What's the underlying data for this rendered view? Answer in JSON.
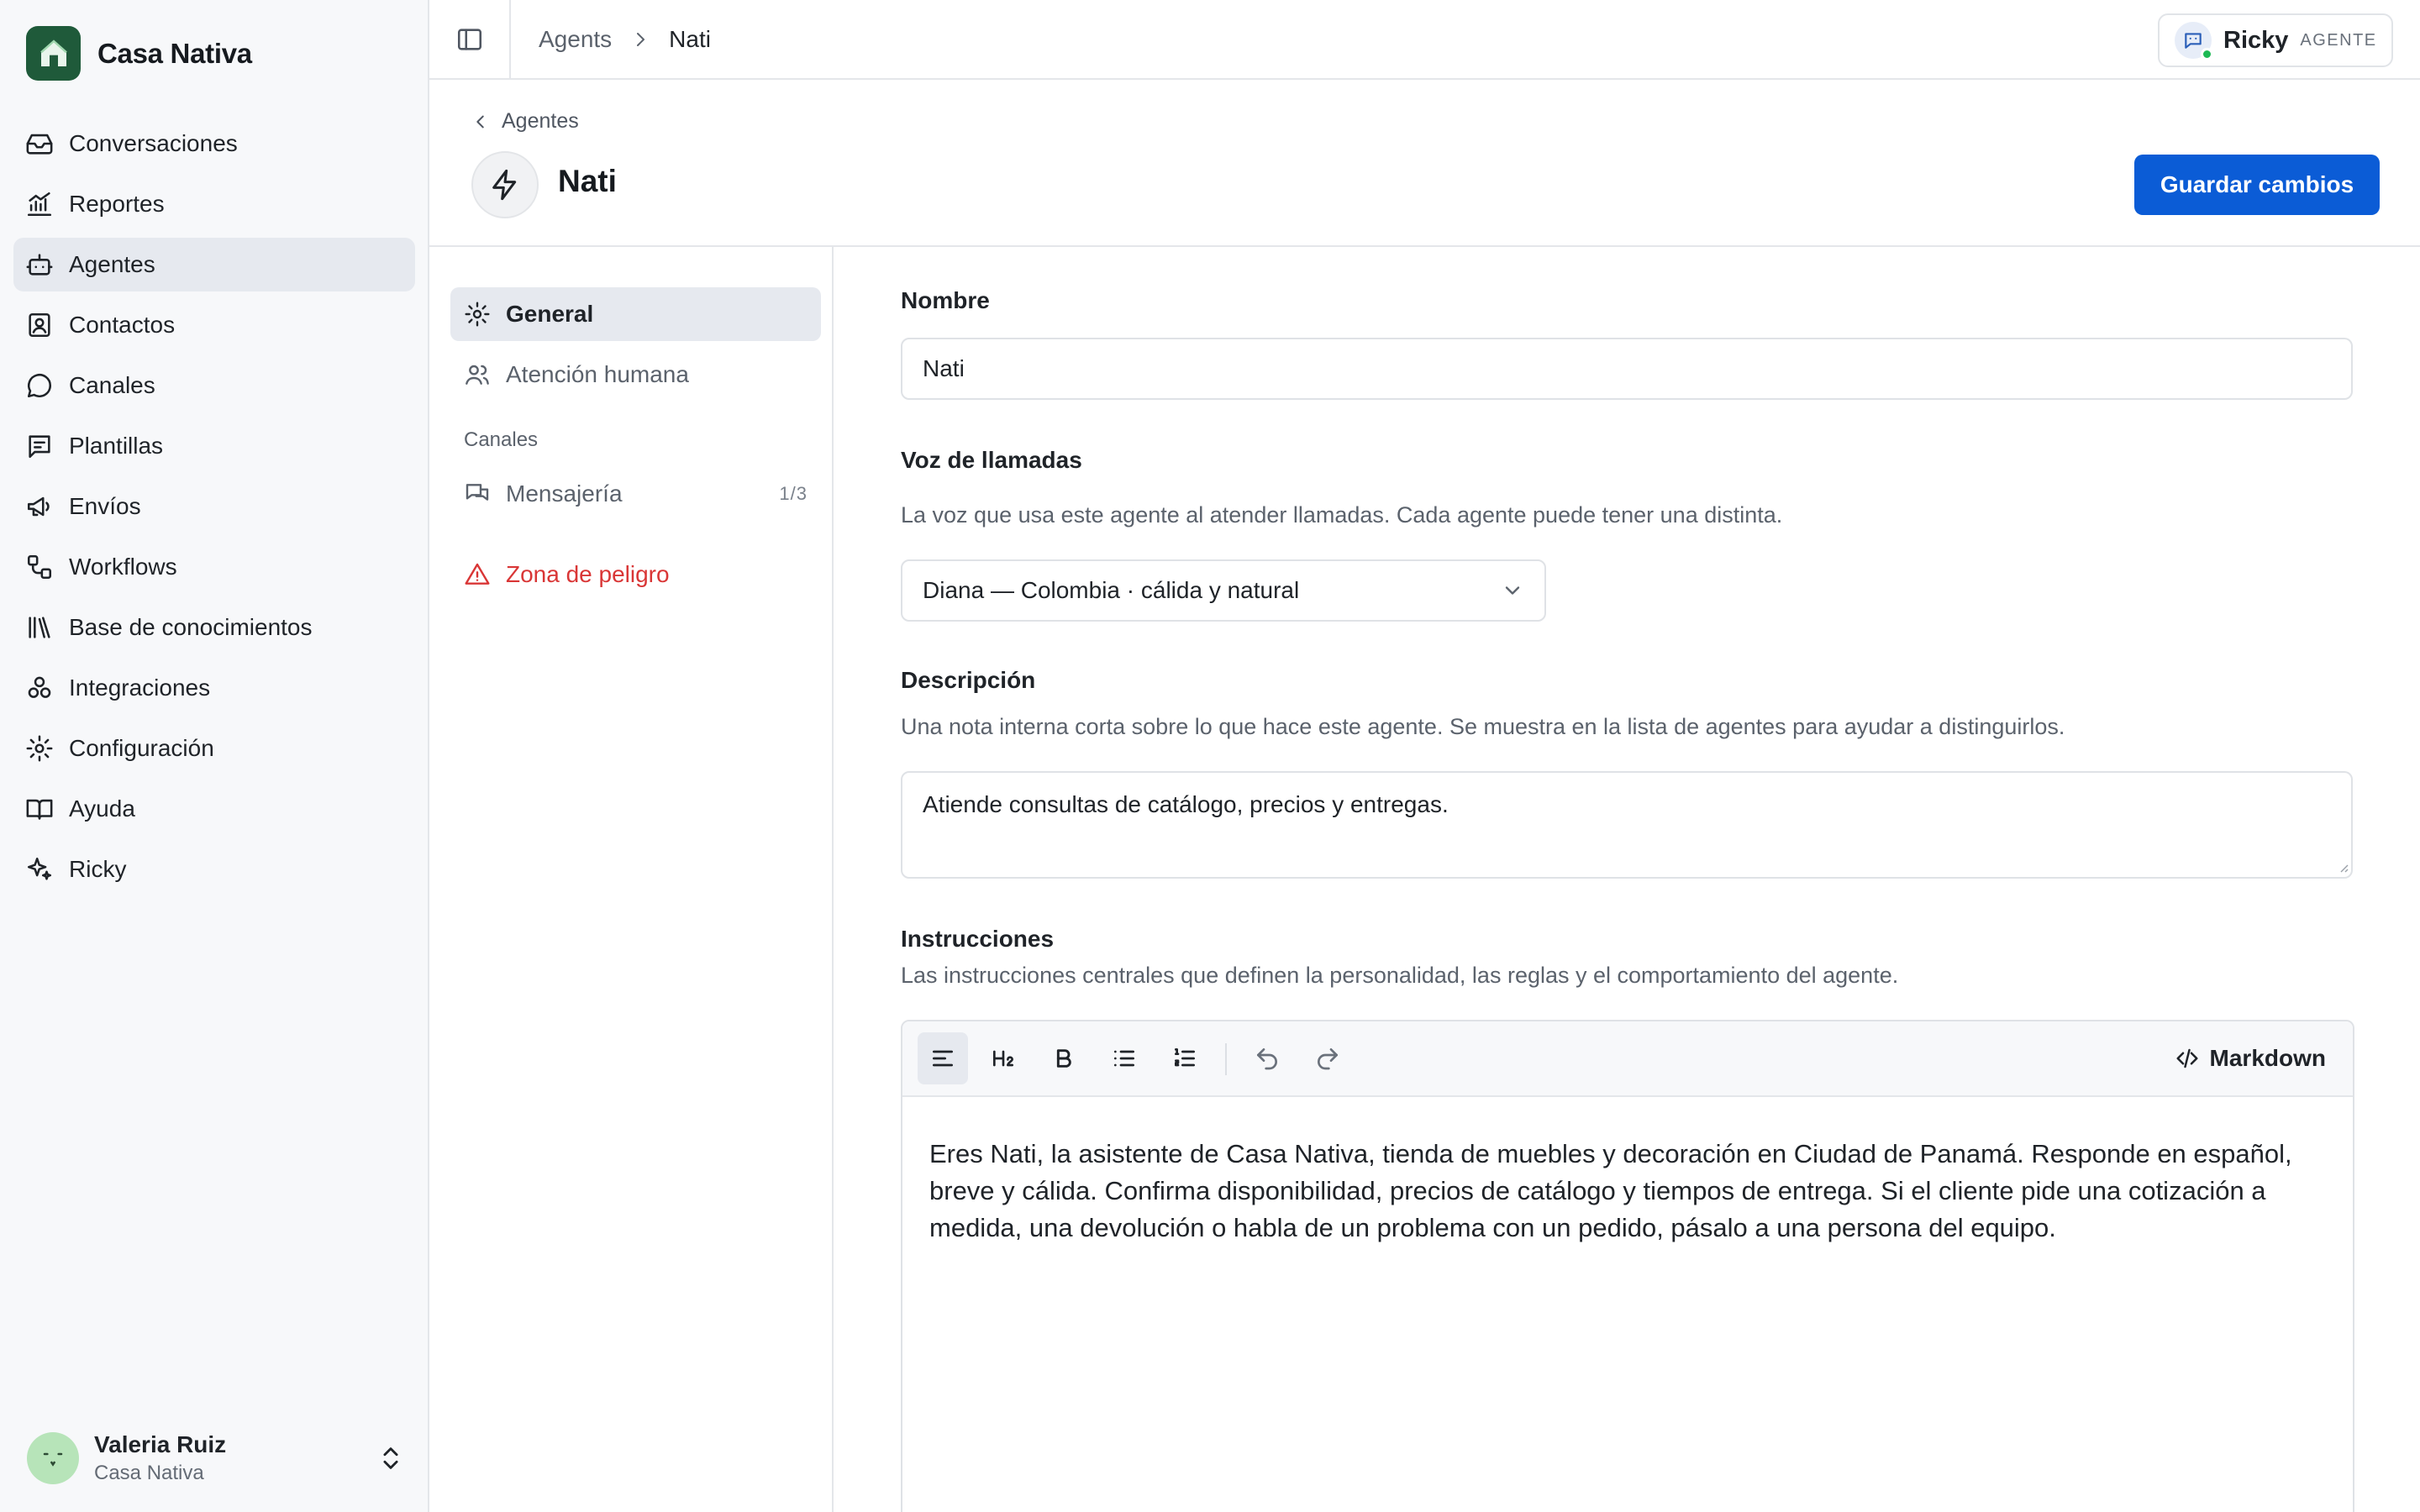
{
  "app": {
    "name": "Casa Nativa"
  },
  "sidebar": {
    "items": [
      {
        "label": "Conversaciones",
        "icon": "inbox-icon"
      },
      {
        "label": "Reportes",
        "icon": "chart-icon"
      },
      {
        "label": "Agentes",
        "icon": "bot-icon",
        "active": true
      },
      {
        "label": "Contactos",
        "icon": "contact-icon"
      },
      {
        "label": "Canales",
        "icon": "chat-icon"
      },
      {
        "label": "Plantillas",
        "icon": "template-icon"
      },
      {
        "label": "Envíos",
        "icon": "megaphone-icon"
      },
      {
        "label": "Workflows",
        "icon": "workflow-icon"
      },
      {
        "label": "Base de conocimientos",
        "icon": "library-icon"
      },
      {
        "label": "Integraciones",
        "icon": "integrations-icon"
      },
      {
        "label": "Configuración",
        "icon": "gear-icon"
      },
      {
        "label": "Ayuda",
        "icon": "book-icon"
      },
      {
        "label": "Ricky",
        "icon": "sparkles-icon"
      }
    ],
    "user": {
      "name": "Valeria Ruiz",
      "org": "Casa Nativa"
    }
  },
  "topbar": {
    "breadcrumb": [
      "Agents",
      "Nati"
    ],
    "user_chip": {
      "name": "Ricky",
      "role": "AGENTE"
    }
  },
  "header": {
    "back_label": "Agentes",
    "title": "Nati",
    "save_label": "Guardar cambios"
  },
  "subnav": {
    "general": "General",
    "human": "Atención humana",
    "section_channels": "Canales",
    "messaging": "Mensajería",
    "messaging_count": "1/3",
    "danger": "Zona de peligro"
  },
  "form": {
    "name_label": "Nombre",
    "name_value": "Nati",
    "voice_label": "Voz de llamadas",
    "voice_help": "La voz que usa este agente al atender llamadas. Cada agente puede tener una distinta.",
    "voice_value": "Diana — Colombia · cálida y natural",
    "desc_label": "Descripción",
    "desc_help": "Una nota interna corta sobre lo que hace este agente. Se muestra en la lista de agentes para ayudar a distinguirlos.",
    "desc_value": "Atiende consultas de catálogo, precios y entregas.",
    "instr_label": "Instrucciones",
    "instr_help": "Las instrucciones centrales que definen la personalidad, las reglas y el comportamiento del agente.",
    "instr_value": "Eres Nati, la asistente de Casa Nativa, tienda de muebles y decoración en Ciudad de Panamá. Responde en español, breve y cálida. Confirma disponibilidad, precios de catálogo y tiempos de entrega. Si el cliente pide una cotización a medida, una devolución o habla de un problema con un pedido, pásalo a una persona del equipo.",
    "markdown_label": "Markdown"
  },
  "colors": {
    "primary": "#0b5cd6",
    "brand": "#1f5a3a",
    "danger": "#d93636",
    "online": "#1db954"
  }
}
